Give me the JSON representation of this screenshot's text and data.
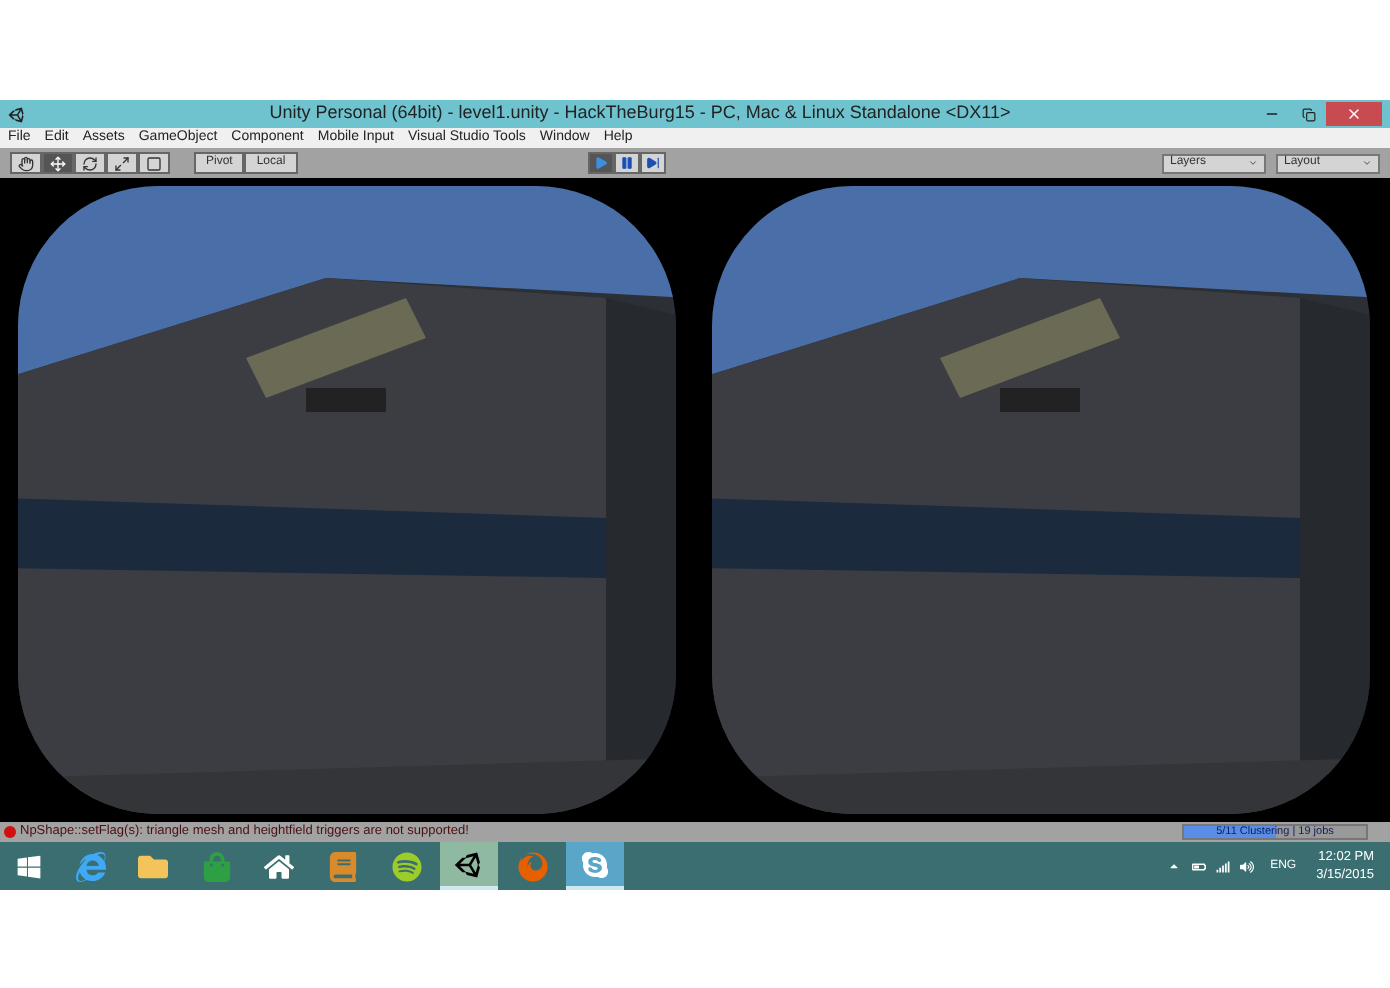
{
  "window": {
    "title": "Unity Personal (64bit) - level1.unity - HackTheBurg15 - PC, Mac & Linux Standalone <DX11>"
  },
  "menu": [
    "File",
    "Edit",
    "Assets",
    "GameObject",
    "Component",
    "Mobile Input",
    "Visual Studio Tools",
    "Window",
    "Help"
  ],
  "toolbar": {
    "tools": [
      {
        "selected": false
      },
      {
        "selected": true
      },
      {
        "selected": false
      },
      {
        "selected": false
      },
      {
        "selected": false
      }
    ],
    "toggles": [
      "Pivot",
      "Local"
    ],
    "playback": [
      {
        "selected": true
      },
      {
        "selected": false
      },
      {
        "selected": false
      }
    ],
    "dropdowns": [
      "Layers",
      "Layout"
    ]
  },
  "status_bar": {
    "message": "NpShape::setFlag(s): triangle mesh and heightfield triggers are not supported!",
    "progress": {
      "label": "5/11 Clustering | 19 jobs",
      "level": 0.5
    }
  },
  "taskbar": {
    "apps": [
      {
        "selected": false,
        "open": false
      },
      {
        "selected": false,
        "open": false
      },
      {
        "selected": false,
        "open": false
      },
      {
        "selected": false,
        "open": false
      },
      {
        "selected": false,
        "open": false
      },
      {
        "selected": false,
        "open": false
      },
      {
        "selected": true,
        "open": true
      },
      {
        "selected": false,
        "open": false
      },
      {
        "selected": false,
        "open": true
      }
    ],
    "language": "ENG",
    "time": "12:02 PM",
    "date": "3/15/2015"
  }
}
